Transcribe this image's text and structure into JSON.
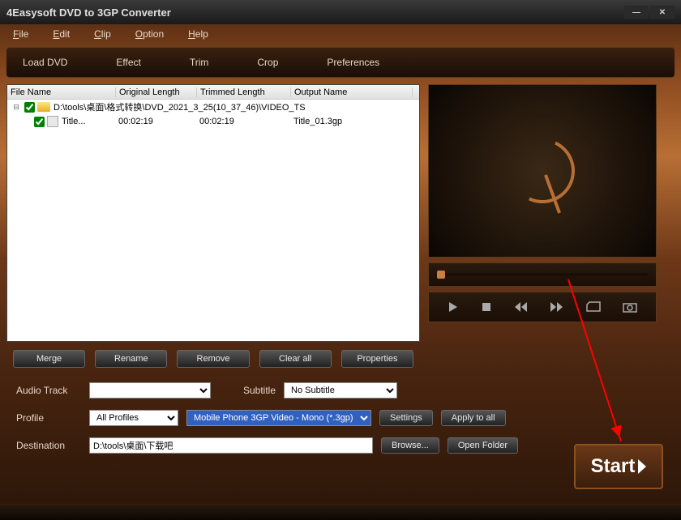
{
  "title": "4Easysoft DVD to 3GP Converter",
  "menu": {
    "file": "File",
    "edit": "Edit",
    "clip": "Clip",
    "option": "Option",
    "help": "Help"
  },
  "toolbar": {
    "load": "Load DVD",
    "effect": "Effect",
    "trim": "Trim",
    "crop": "Crop",
    "prefs": "Preferences"
  },
  "filehdr": {
    "name": "File Name",
    "orig": "Original Length",
    "trim": "Trimmed Length",
    "out": "Output Name"
  },
  "rows": [
    {
      "tree": "⊟",
      "name": "D:\\tools\\桌面\\格式转换\\DVD_2021_3_25(10_37_46)\\VIDEO_TS",
      "orig": "",
      "trim": "",
      "out": ""
    },
    {
      "tree": "",
      "name": "Title...",
      "orig": "00:02:19",
      "trim": "00:02:19",
      "out": "Title_01.3gp"
    }
  ],
  "btns": {
    "merge": "Merge",
    "rename": "Rename",
    "remove": "Remove",
    "clear": "Clear all",
    "props": "Properties"
  },
  "labels": {
    "audio": "Audio Track",
    "subtitle": "Subtitle",
    "nosub": "No Subtitle",
    "profile": "Profile",
    "allprof": "All Profiles",
    "profval": "Mobile Phone 3GP Video - Mono (*.3gp)",
    "settings": "Settings",
    "apply": "Apply to all",
    "dest": "Destination",
    "destval": "D:\\tools\\桌面\\下载吧",
    "browse": "Browse...",
    "openf": "Open Folder",
    "start": "Start"
  }
}
